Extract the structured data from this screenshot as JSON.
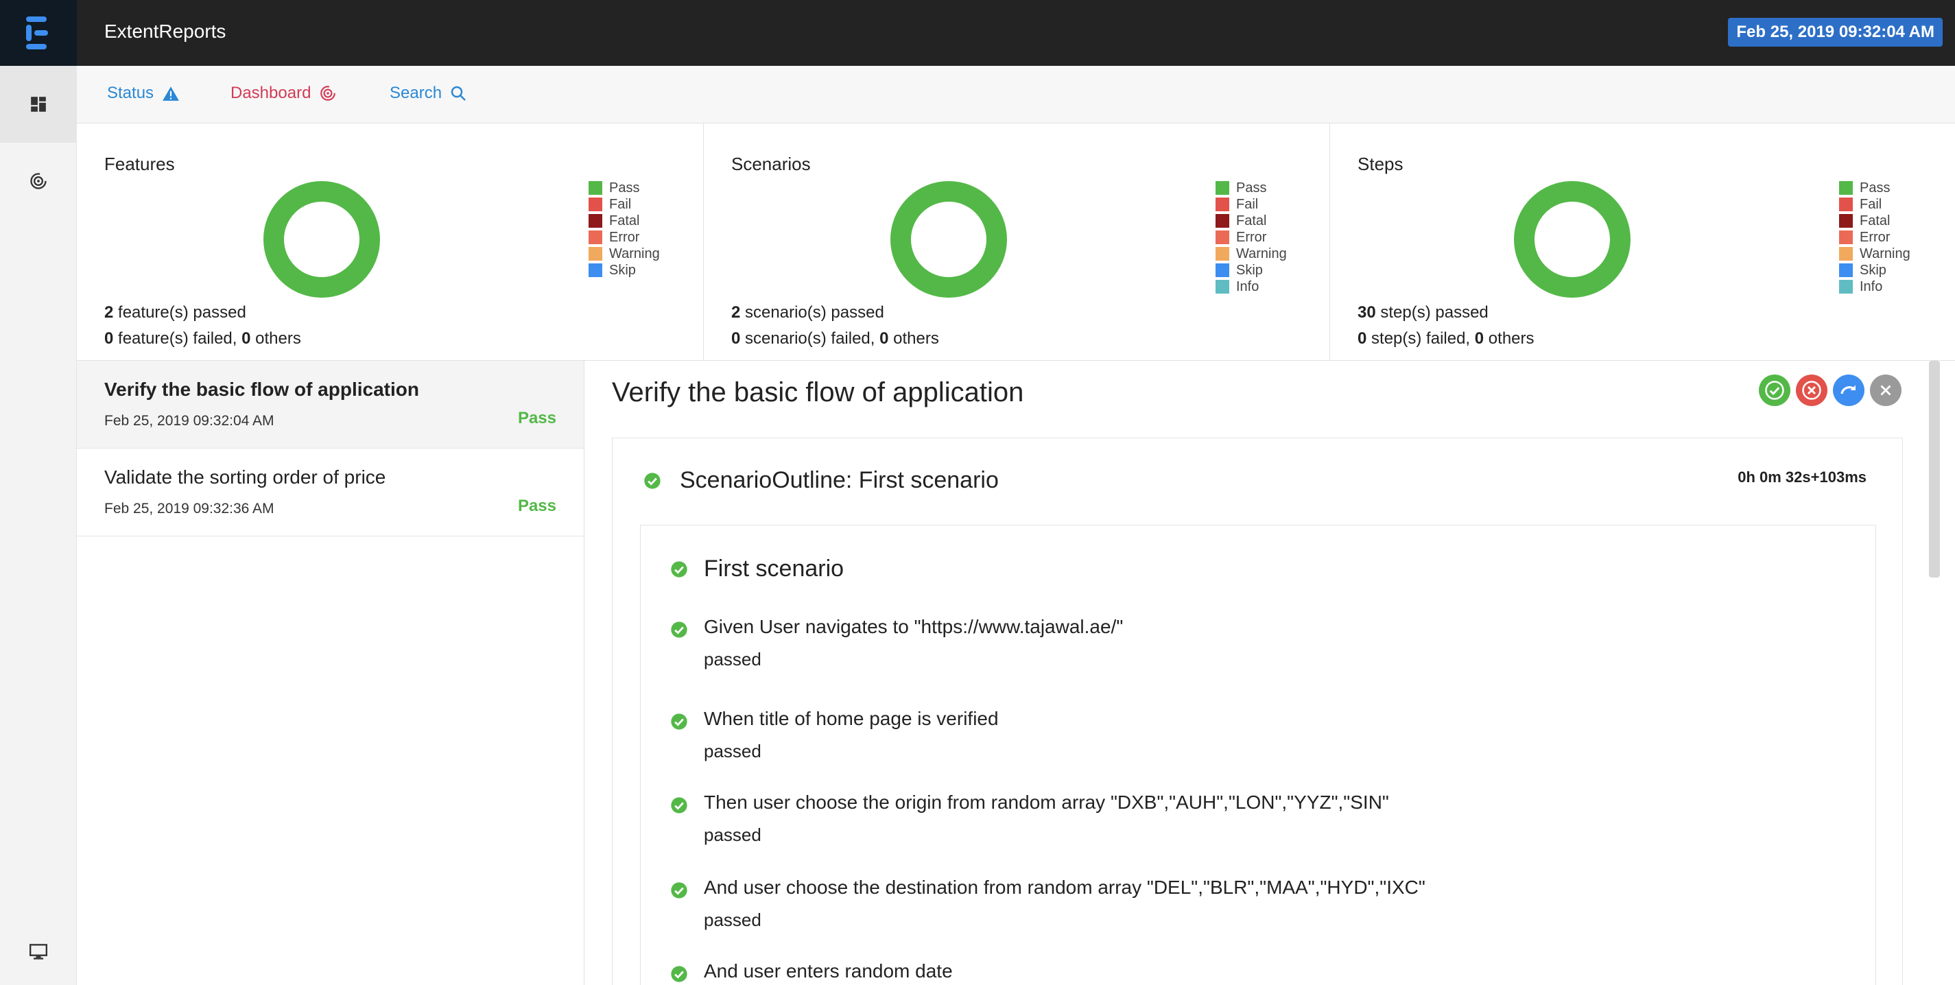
{
  "app": {
    "brand": "ExtentReports",
    "date": "Feb 25, 2019 09:32:04 AM"
  },
  "nav": {
    "status": "Status",
    "dashboard": "Dashboard",
    "search": "Search"
  },
  "colors": {
    "pass": "#53b847",
    "fail": "#e2524a",
    "fatal": "#8e1a1a",
    "error": "#ea6a55",
    "warning": "#f1a95d",
    "skip": "#3d8ef0",
    "info": "#5fbcc2"
  },
  "cards": {
    "features": {
      "title": "Features",
      "legend": [
        "Pass",
        "Fail",
        "Fatal",
        "Error",
        "Warning",
        "Skip"
      ],
      "passed_count": "2",
      "passed_label": "feature(s) passed",
      "failed_count": "0",
      "failed_label": "feature(s) failed,",
      "others_count": "0",
      "others_label": "others"
    },
    "scenarios": {
      "title": "Scenarios",
      "legend": [
        "Pass",
        "Fail",
        "Fatal",
        "Error",
        "Warning",
        "Skip",
        "Info"
      ],
      "passed_count": "2",
      "passed_label": "scenario(s) passed",
      "failed_count": "0",
      "failed_label": "scenario(s) failed,",
      "others_count": "0",
      "others_label": "others"
    },
    "steps": {
      "title": "Steps",
      "legend": [
        "Pass",
        "Fail",
        "Fatal",
        "Error",
        "Warning",
        "Skip",
        "Info"
      ],
      "passed_count": "30",
      "passed_label": "step(s) passed",
      "failed_count": "0",
      "failed_label": "step(s) failed,",
      "others_count": "0",
      "others_label": "others"
    }
  },
  "tests": [
    {
      "name": "Verify the basic flow of application",
      "date": "Feb 25, 2019 09:32:04 AM",
      "status": "Pass"
    },
    {
      "name": "Validate the sorting order of price",
      "date": "Feb 25, 2019 09:32:36 AM",
      "status": "Pass"
    }
  ],
  "detail": {
    "title": "Verify the basic flow of application",
    "outline": "ScenarioOutline: First scenario",
    "duration": "0h 0m 32s+103ms",
    "scenario": "First scenario",
    "steps": [
      {
        "text": "Given User navigates to \"https://www.tajawal.ae/\"",
        "result": "passed"
      },
      {
        "text": "When title of home page is verified",
        "result": "passed"
      },
      {
        "text": "Then user choose the origin from random array \"DXB\",\"AUH\",\"LON\",\"YYZ\",\"SIN\"",
        "result": "passed"
      },
      {
        "text": "And user choose the destination from random array \"DEL\",\"BLR\",\"MAA\",\"HYD\",\"IXC\"",
        "result": "passed"
      },
      {
        "text": "And user enters random date",
        "result": ""
      }
    ]
  }
}
